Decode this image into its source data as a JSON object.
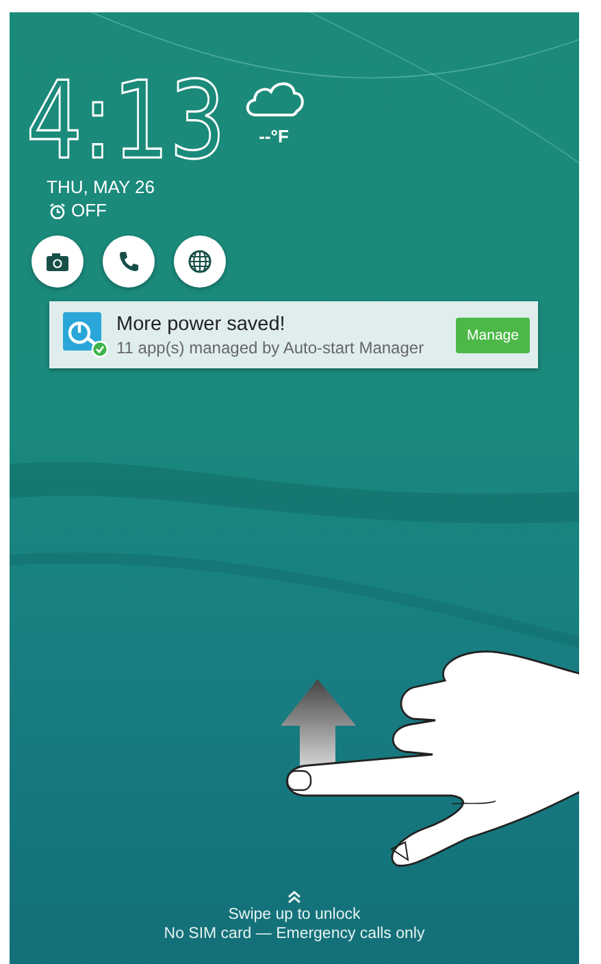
{
  "clock": {
    "time": "4:13",
    "temperature": "--°F",
    "date": "THU, MAY 26",
    "alarm": "OFF"
  },
  "shortcuts": [
    {
      "kind": "camera"
    },
    {
      "kind": "phone"
    },
    {
      "kind": "browser"
    }
  ],
  "notification": {
    "title": "More power saved!",
    "body": "11 app(s) managed by Auto-start Manager",
    "button": "Manage"
  },
  "unlock": {
    "hint": "Swipe up to unlock",
    "status": "No SIM card — Emergency calls only"
  }
}
